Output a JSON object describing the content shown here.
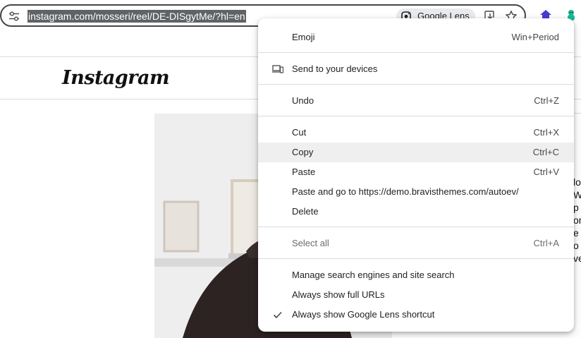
{
  "browser": {
    "url": "instagram.com/mosseri/reel/DE-DISgytMe/?hl=en",
    "lens_chip_label": "Google Lens"
  },
  "page": {
    "logo_text": "Instagram",
    "caption_fragments": [
      "lo",
      "W",
      "p",
      "on",
      "e",
      "o",
      "ve"
    ]
  },
  "context_menu": {
    "items": [
      {
        "label": "Emoji",
        "shortcut": "Win+Period"
      },
      {
        "label": "Send to your devices",
        "shortcut": "",
        "icon": "devices-icon"
      },
      {
        "label": "Undo",
        "shortcut": "Ctrl+Z"
      },
      {
        "label": "Cut",
        "shortcut": "Ctrl+X"
      },
      {
        "label": "Copy",
        "shortcut": "Ctrl+C",
        "highlighted": true
      },
      {
        "label": "Paste",
        "shortcut": "Ctrl+V"
      },
      {
        "label": "Paste and go to https://demo.bravisthemes.com/autoev/",
        "shortcut": ""
      },
      {
        "label": "Delete",
        "shortcut": ""
      },
      {
        "label": "Select all",
        "shortcut": "Ctrl+A",
        "disabled": true
      },
      {
        "label": "Manage search engines and site search",
        "shortcut": ""
      },
      {
        "label": "Always show full URLs",
        "shortcut": ""
      },
      {
        "label": "Always show Google Lens shortcut",
        "shortcut": "",
        "checked": true,
        "icon": "checkmark-icon"
      }
    ]
  },
  "colors": {
    "url_selection_bg": "#5f6368",
    "extension_purple": "#4a3ad1",
    "extension_teal": "#1bb89a",
    "menu_highlight": "#efefef"
  }
}
